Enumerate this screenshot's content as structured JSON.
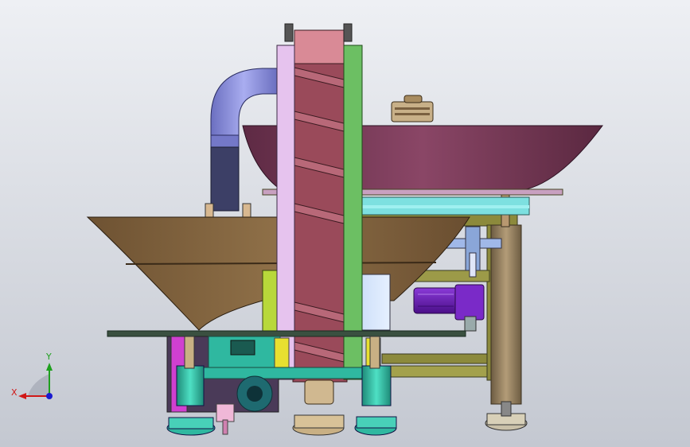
{
  "view": {
    "background_top": "#eef0f4",
    "background_bottom": "#c4c8d1"
  },
  "triad": {
    "x_label": "X",
    "y_label": "Y",
    "x_color": "#d01818",
    "y_color": "#1ea01e",
    "z_color": "#1a1ad0"
  },
  "colors": {
    "upper_bowl": "#7a3a58",
    "lower_bowl": "#7a6040",
    "chute_pink": "#d98a96",
    "left_rail": "#e6c3ee",
    "right_rail": "#6cbf63",
    "duct": "#8b8fd8",
    "duct_dark": "#3c3f66",
    "motor": "#6a1fb0",
    "teal": "#2fb8a0",
    "olive": "#8c8a3c",
    "post": "#8f7a5a",
    "cyan": "#7de0e0",
    "yellow_green": "#b8d83a",
    "magenta": "#d040d0"
  }
}
